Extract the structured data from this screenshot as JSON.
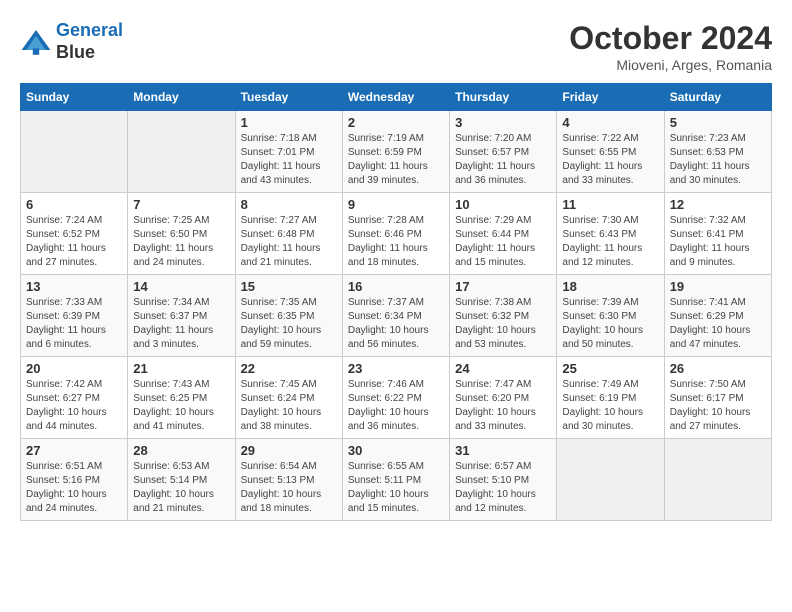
{
  "header": {
    "logo_line1": "General",
    "logo_line2": "Blue",
    "month": "October 2024",
    "location": "Mioveni, Arges, Romania"
  },
  "weekdays": [
    "Sunday",
    "Monday",
    "Tuesday",
    "Wednesday",
    "Thursday",
    "Friday",
    "Saturday"
  ],
  "weeks": [
    [
      {
        "day": "",
        "info": ""
      },
      {
        "day": "",
        "info": ""
      },
      {
        "day": "1",
        "info": "Sunrise: 7:18 AM\nSunset: 7:01 PM\nDaylight: 11 hours and 43 minutes."
      },
      {
        "day": "2",
        "info": "Sunrise: 7:19 AM\nSunset: 6:59 PM\nDaylight: 11 hours and 39 minutes."
      },
      {
        "day": "3",
        "info": "Sunrise: 7:20 AM\nSunset: 6:57 PM\nDaylight: 11 hours and 36 minutes."
      },
      {
        "day": "4",
        "info": "Sunrise: 7:22 AM\nSunset: 6:55 PM\nDaylight: 11 hours and 33 minutes."
      },
      {
        "day": "5",
        "info": "Sunrise: 7:23 AM\nSunset: 6:53 PM\nDaylight: 11 hours and 30 minutes."
      }
    ],
    [
      {
        "day": "6",
        "info": "Sunrise: 7:24 AM\nSunset: 6:52 PM\nDaylight: 11 hours and 27 minutes."
      },
      {
        "day": "7",
        "info": "Sunrise: 7:25 AM\nSunset: 6:50 PM\nDaylight: 11 hours and 24 minutes."
      },
      {
        "day": "8",
        "info": "Sunrise: 7:27 AM\nSunset: 6:48 PM\nDaylight: 11 hours and 21 minutes."
      },
      {
        "day": "9",
        "info": "Sunrise: 7:28 AM\nSunset: 6:46 PM\nDaylight: 11 hours and 18 minutes."
      },
      {
        "day": "10",
        "info": "Sunrise: 7:29 AM\nSunset: 6:44 PM\nDaylight: 11 hours and 15 minutes."
      },
      {
        "day": "11",
        "info": "Sunrise: 7:30 AM\nSunset: 6:43 PM\nDaylight: 11 hours and 12 minutes."
      },
      {
        "day": "12",
        "info": "Sunrise: 7:32 AM\nSunset: 6:41 PM\nDaylight: 11 hours and 9 minutes."
      }
    ],
    [
      {
        "day": "13",
        "info": "Sunrise: 7:33 AM\nSunset: 6:39 PM\nDaylight: 11 hours and 6 minutes."
      },
      {
        "day": "14",
        "info": "Sunrise: 7:34 AM\nSunset: 6:37 PM\nDaylight: 11 hours and 3 minutes."
      },
      {
        "day": "15",
        "info": "Sunrise: 7:35 AM\nSunset: 6:35 PM\nDaylight: 10 hours and 59 minutes."
      },
      {
        "day": "16",
        "info": "Sunrise: 7:37 AM\nSunset: 6:34 PM\nDaylight: 10 hours and 56 minutes."
      },
      {
        "day": "17",
        "info": "Sunrise: 7:38 AM\nSunset: 6:32 PM\nDaylight: 10 hours and 53 minutes."
      },
      {
        "day": "18",
        "info": "Sunrise: 7:39 AM\nSunset: 6:30 PM\nDaylight: 10 hours and 50 minutes."
      },
      {
        "day": "19",
        "info": "Sunrise: 7:41 AM\nSunset: 6:29 PM\nDaylight: 10 hours and 47 minutes."
      }
    ],
    [
      {
        "day": "20",
        "info": "Sunrise: 7:42 AM\nSunset: 6:27 PM\nDaylight: 10 hours and 44 minutes."
      },
      {
        "day": "21",
        "info": "Sunrise: 7:43 AM\nSunset: 6:25 PM\nDaylight: 10 hours and 41 minutes."
      },
      {
        "day": "22",
        "info": "Sunrise: 7:45 AM\nSunset: 6:24 PM\nDaylight: 10 hours and 38 minutes."
      },
      {
        "day": "23",
        "info": "Sunrise: 7:46 AM\nSunset: 6:22 PM\nDaylight: 10 hours and 36 minutes."
      },
      {
        "day": "24",
        "info": "Sunrise: 7:47 AM\nSunset: 6:20 PM\nDaylight: 10 hours and 33 minutes."
      },
      {
        "day": "25",
        "info": "Sunrise: 7:49 AM\nSunset: 6:19 PM\nDaylight: 10 hours and 30 minutes."
      },
      {
        "day": "26",
        "info": "Sunrise: 7:50 AM\nSunset: 6:17 PM\nDaylight: 10 hours and 27 minutes."
      }
    ],
    [
      {
        "day": "27",
        "info": "Sunrise: 6:51 AM\nSunset: 5:16 PM\nDaylight: 10 hours and 24 minutes."
      },
      {
        "day": "28",
        "info": "Sunrise: 6:53 AM\nSunset: 5:14 PM\nDaylight: 10 hours and 21 minutes."
      },
      {
        "day": "29",
        "info": "Sunrise: 6:54 AM\nSunset: 5:13 PM\nDaylight: 10 hours and 18 minutes."
      },
      {
        "day": "30",
        "info": "Sunrise: 6:55 AM\nSunset: 5:11 PM\nDaylight: 10 hours and 15 minutes."
      },
      {
        "day": "31",
        "info": "Sunrise: 6:57 AM\nSunset: 5:10 PM\nDaylight: 10 hours and 12 minutes."
      },
      {
        "day": "",
        "info": ""
      },
      {
        "day": "",
        "info": ""
      }
    ]
  ]
}
